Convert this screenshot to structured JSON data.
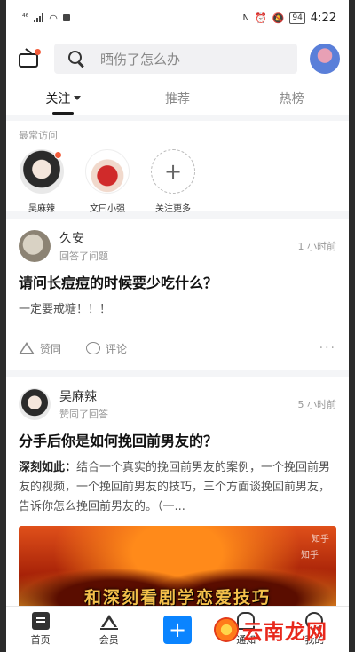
{
  "status_bar": {
    "signal": "⁴⁶",
    "battery": "94",
    "time": "4:22"
  },
  "header": {
    "search_placeholder": "晒伤了怎么办"
  },
  "tabs": [
    {
      "label": "关注"
    },
    {
      "label": "推荐"
    },
    {
      "label": "热榜"
    }
  ],
  "frequent": {
    "title": "最常访问",
    "items": [
      {
        "name": "吴麻辣"
      },
      {
        "name": "文曰小强"
      },
      {
        "name": "关注更多"
      }
    ]
  },
  "feed": [
    {
      "author": "久安",
      "action": "回答了问题",
      "time": "1 小时前",
      "question": "请问长痘痘的时候要少吃什么？",
      "answer": "一定要戒糖！！！",
      "like_label": "赞同",
      "comment_label": "评论",
      "more": "···"
    },
    {
      "author": "吴麻辣",
      "action": "赞同了回答",
      "time": "5 小时前",
      "question": "分手后你是如何挽回前男友的？",
      "answer_author": "深刻如此：",
      "answer": "结合一个真实的挽回前男友的案例，一个挽回前男友的视频，一个挽回前男友的技巧，三个方面谈挽回前男友，告诉你怎么挽回前男友的。（一...",
      "thumbnail_text": "和深刻看剧学恋爱技巧",
      "thumbnail_wm1": "知乎",
      "thumbnail_wm2": "知乎"
    }
  ],
  "bottom_nav": [
    {
      "label": "首页"
    },
    {
      "label": "会员"
    },
    {
      "label": "+"
    },
    {
      "label": "通知"
    },
    {
      "label": "我的"
    }
  ],
  "watermark": "云南龙网",
  "colors": {
    "accent_blue": "#0a84ff",
    "notify_red": "#f25c3b"
  }
}
